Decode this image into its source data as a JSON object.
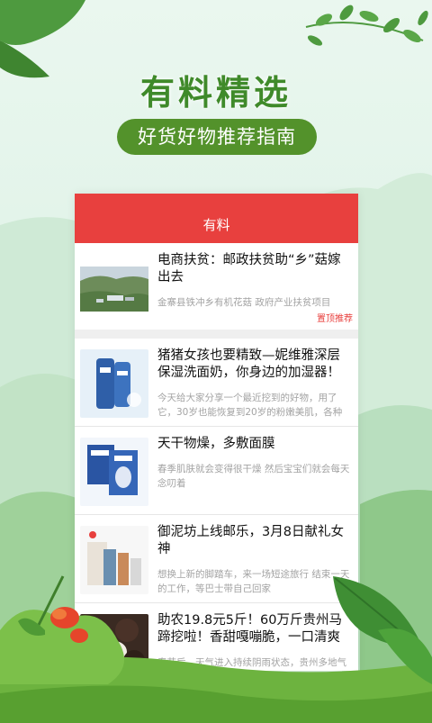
{
  "headline": "有料精选",
  "subtitle": "好货好物推荐指南",
  "app": {
    "header_title": "有料",
    "articles": [
      {
        "title": "电商扶贫：邮政扶贫助“乡”菇嫁出去",
        "desc": "金寨县铁冲乡有机花菇 政府产业扶贫项目",
        "tag": "置顶推荐",
        "thumb": "aerial-farm-photo"
      },
      {
        "title": "猪猪女孩也要精致—妮维雅深层保湿洗面奶，你身边的加湿器！",
        "desc": "今天给大家分享一个最近挖到的好物，用了它，30岁也能恢复到20岁的粉嫩美肌，各种干燥肌...",
        "thumb": "facial-cleanser-product-photo"
      },
      {
        "title": "天干物燥，多敷面膜",
        "desc": "春季肌肤就会变得很干燥 然后宝宝们就会每天念叨着",
        "thumb": "face-mask-product-photo"
      },
      {
        "title": "御泥坊上线邮乐，3月8日献礼女神",
        "desc": "想换上新的脚踏车，来一场短途旅行 结束一天的工作，等巴士带自己回家",
        "thumb": "cosmetics-set-product-photo"
      },
      {
        "title": "助农19.8元5斤！60万斤贵州马蹄挖啦！香甜嘎嘣脆，一口清爽",
        "desc": "春节后，天气进入持续阴雨状态，贵州多地气温...",
        "thumb": "water-chestnut-photo"
      }
    ]
  },
  "colors": {
    "brand_green": "#53922b",
    "headline_green": "#3f8a2a",
    "header_red": "#e8403e"
  }
}
